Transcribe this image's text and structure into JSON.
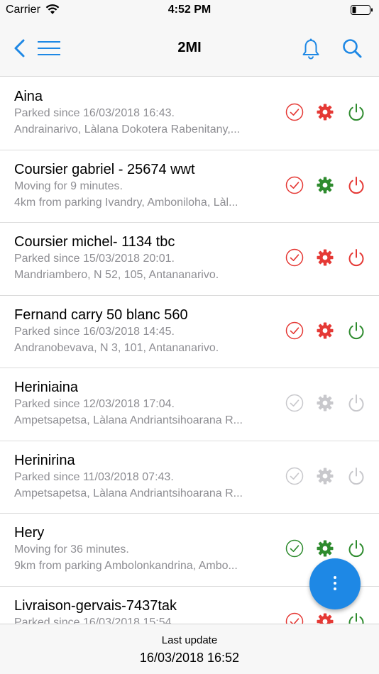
{
  "status_bar": {
    "carrier": "Carrier",
    "time": "4:52 PM"
  },
  "header": {
    "title": "2MI"
  },
  "colors": {
    "accent": "#1e88e5",
    "red": "#e53935",
    "green": "#2e8b2e",
    "gray": "#c8c8cc"
  },
  "vehicles": [
    {
      "name": "Aina",
      "status": "Parked since 16/03/2018 16:43.",
      "address": "Andrainarivo, Làlana Dokotera Rabenitany,...",
      "check": "red",
      "gear": "red",
      "power": "green"
    },
    {
      "name": "Coursier gabriel - 25674 wwt",
      "status": "Moving for 9 minutes.",
      "address": "4km from parking Ivandry, Amboniloha, Làl...",
      "check": "red",
      "gear": "green",
      "power": "red"
    },
    {
      "name": "Coursier michel- 1134 tbc",
      "status": "Parked since 15/03/2018 20:01.",
      "address": "Mandriambero, N 52, 105, Antananarivo.",
      "check": "red",
      "gear": "red",
      "power": "red"
    },
    {
      "name": "Fernand carry 50 blanc 560",
      "status": "Parked since 16/03/2018 14:45.",
      "address": "Andranobevava, N 3, 101, Antananarivo.",
      "check": "red",
      "gear": "red",
      "power": "green"
    },
    {
      "name": "Heriniaina",
      "status": "Parked since 12/03/2018 17:04.",
      "address": "Ampetsapetsa, Làlana Andriantsihoarana R...",
      "check": "gray",
      "gear": "gray",
      "power": "gray"
    },
    {
      "name": "Herinirina",
      "status": "Parked since 11/03/2018 07:43.",
      "address": "Ampetsapetsa, Làlana Andriantsihoarana R...",
      "check": "gray",
      "gear": "gray",
      "power": "gray"
    },
    {
      "name": "Hery",
      "status": "Moving for 36 minutes.",
      "address": "9km from parking Ambolonkandrina, Ambo...",
      "check": "green",
      "gear": "green",
      "power": "green"
    },
    {
      "name": "Livraison-gervais-7437tak",
      "status": "Parked since 16/03/2018 15:54.",
      "address": "",
      "check": "red",
      "gear": "red",
      "power": "green"
    }
  ],
  "footer": {
    "label": "Last update",
    "value": "16/03/2018 16:52"
  }
}
